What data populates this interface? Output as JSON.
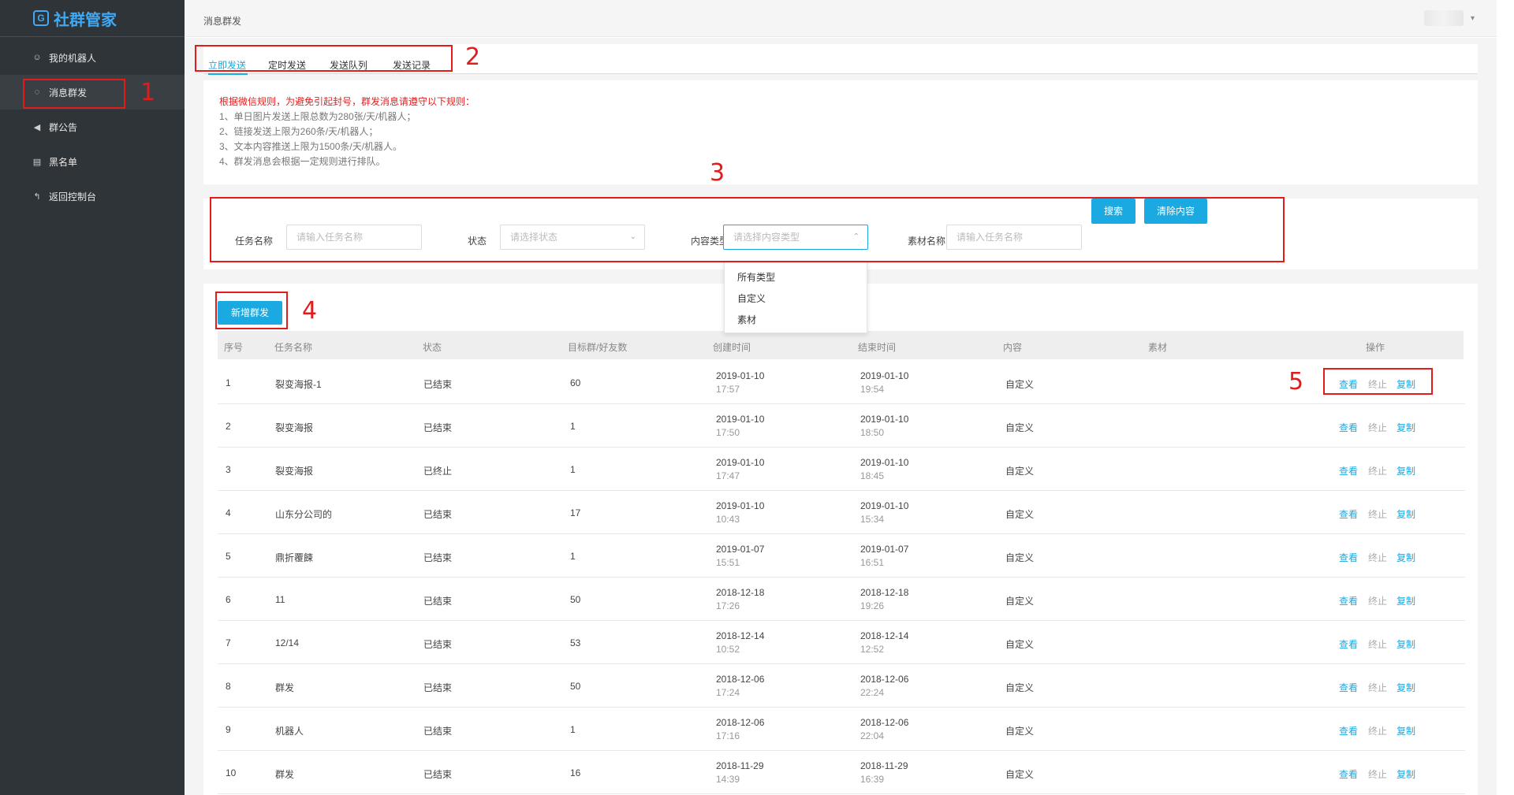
{
  "app": {
    "logo": "社群管家"
  },
  "sidebar": {
    "items": [
      {
        "label": "我的机器人",
        "icon": "user-circle-icon",
        "glyph": "☺"
      },
      {
        "label": "消息群发",
        "icon": "chat-bubble-icon",
        "glyph": "◌"
      },
      {
        "label": "群公告",
        "icon": "megaphone-icon",
        "glyph": "◀"
      },
      {
        "label": "黑名单",
        "icon": "id-card-icon",
        "glyph": "▤"
      },
      {
        "label": "返回控制台",
        "icon": "back-arrow-icon",
        "glyph": "↰"
      }
    ]
  },
  "header": {
    "title": "消息群发"
  },
  "tabs": [
    "立即发送",
    "定时发送",
    "发送队列",
    "发送记录"
  ],
  "rules": {
    "head": "根据微信规则，为避免引起封号，群发消息请遵守以下规则：",
    "lines": [
      "1、单日图片发送上限总数为280张/天/机器人；",
      "2、链接发送上限为260条/天/机器人；",
      "3、文本内容推送上限为1500条/天/机器人。",
      "4、群发消息会根据一定规则进行排队。"
    ]
  },
  "filter": {
    "task_name_label": "任务名称",
    "task_name_placeholder": "请输入任务名称",
    "status_label": "状态",
    "status_placeholder": "请选择状态",
    "content_type_label": "内容类型",
    "content_type_placeholder": "请选择内容类型",
    "material_label": "素材名称",
    "material_placeholder": "请输入任务名称",
    "search_button": "搜索",
    "clear_button": "清除内容",
    "content_type_options": [
      "所有类型",
      "自定义",
      "素材"
    ]
  },
  "table": {
    "add_button": "新增群发",
    "columns": [
      "序号",
      "任务名称",
      "状态",
      "目标群/好友数",
      "创建时间",
      "结束时间",
      "内容",
      "素材",
      "操作"
    ],
    "actions": {
      "view": "查看",
      "stop": "终止",
      "copy": "复制"
    },
    "rows": [
      {
        "no": "1",
        "name": "裂变海报-1",
        "status": "已结束",
        "targets": "60",
        "created_date": "2019-01-10",
        "created_time": "17:57",
        "ended_date": "2019-01-10",
        "ended_time": "19:54",
        "content": "自定义",
        "material": ""
      },
      {
        "no": "2",
        "name": "裂变海报",
        "status": "已结束",
        "targets": "1",
        "created_date": "2019-01-10",
        "created_time": "17:50",
        "ended_date": "2019-01-10",
        "ended_time": "18:50",
        "content": "自定义",
        "material": ""
      },
      {
        "no": "3",
        "name": "裂变海报",
        "status": "已终止",
        "targets": "1",
        "created_date": "2019-01-10",
        "created_time": "17:47",
        "ended_date": "2019-01-10",
        "ended_time": "18:45",
        "content": "自定义",
        "material": ""
      },
      {
        "no": "4",
        "name": "山东分公司的",
        "status": "已结束",
        "targets": "17",
        "created_date": "2019-01-10",
        "created_time": "10:43",
        "ended_date": "2019-01-10",
        "ended_time": "15:34",
        "content": "自定义",
        "material": ""
      },
      {
        "no": "5",
        "name": "鼎折覆餗",
        "status": "已结束",
        "targets": "1",
        "created_date": "2019-01-07",
        "created_time": "15:51",
        "ended_date": "2019-01-07",
        "ended_time": "16:51",
        "content": "自定义",
        "material": ""
      },
      {
        "no": "6",
        "name": "11",
        "status": "已结束",
        "targets": "50",
        "created_date": "2018-12-18",
        "created_time": "17:26",
        "ended_date": "2018-12-18",
        "ended_time": "19:26",
        "content": "自定义",
        "material": ""
      },
      {
        "no": "7",
        "name": "12/14",
        "status": "已结束",
        "targets": "53",
        "created_date": "2018-12-14",
        "created_time": "10:52",
        "ended_date": "2018-12-14",
        "ended_time": "12:52",
        "content": "自定义",
        "material": ""
      },
      {
        "no": "8",
        "name": "群发",
        "status": "已结束",
        "targets": "50",
        "created_date": "2018-12-06",
        "created_time": "17:24",
        "ended_date": "2018-12-06",
        "ended_time": "22:24",
        "content": "自定义",
        "material": ""
      },
      {
        "no": "9",
        "name": "机器人",
        "status": "已结束",
        "targets": "1",
        "created_date": "2018-12-06",
        "created_time": "17:16",
        "ended_date": "2018-12-06",
        "ended_time": "22:04",
        "content": "自定义",
        "material": ""
      },
      {
        "no": "10",
        "name": "群发",
        "status": "已结束",
        "targets": "16",
        "created_date": "2018-11-29",
        "created_time": "14:39",
        "ended_date": "2018-11-29",
        "ended_time": "16:39",
        "content": "自定义",
        "material": ""
      }
    ]
  },
  "annotations": [
    "1",
    "2",
    "3",
    "4",
    "5"
  ],
  "colors": {
    "accent": "#1ba9e1",
    "sidebar_bg": "#2f3438",
    "highlight_red": "#e21b1b",
    "rule_red": "#e02020"
  }
}
